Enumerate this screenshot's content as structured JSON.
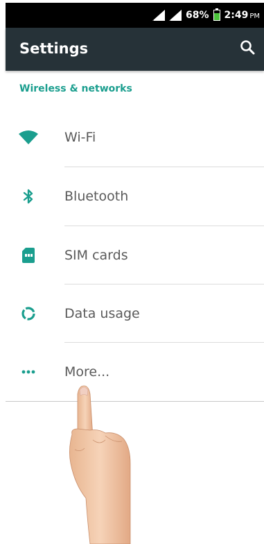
{
  "status_bar": {
    "battery_percent": "68%",
    "battery_level": 0.68,
    "time": "2:49",
    "ampm": "PM",
    "battery_color": "#4bc43b"
  },
  "app_bar": {
    "title": "Settings",
    "search_icon": "search-icon",
    "background": "#263238"
  },
  "section": {
    "title": "Wireless & networks",
    "accent": "#1a9e8e"
  },
  "items": [
    {
      "label": "Wi-Fi",
      "icon": "wifi-icon"
    },
    {
      "label": "Bluetooth",
      "icon": "bluetooth-icon"
    },
    {
      "label": "SIM cards",
      "icon": "sim-card-icon"
    },
    {
      "label": "Data usage",
      "icon": "data-usage-icon"
    },
    {
      "label": "More...",
      "icon": "more-dots-icon"
    }
  ]
}
